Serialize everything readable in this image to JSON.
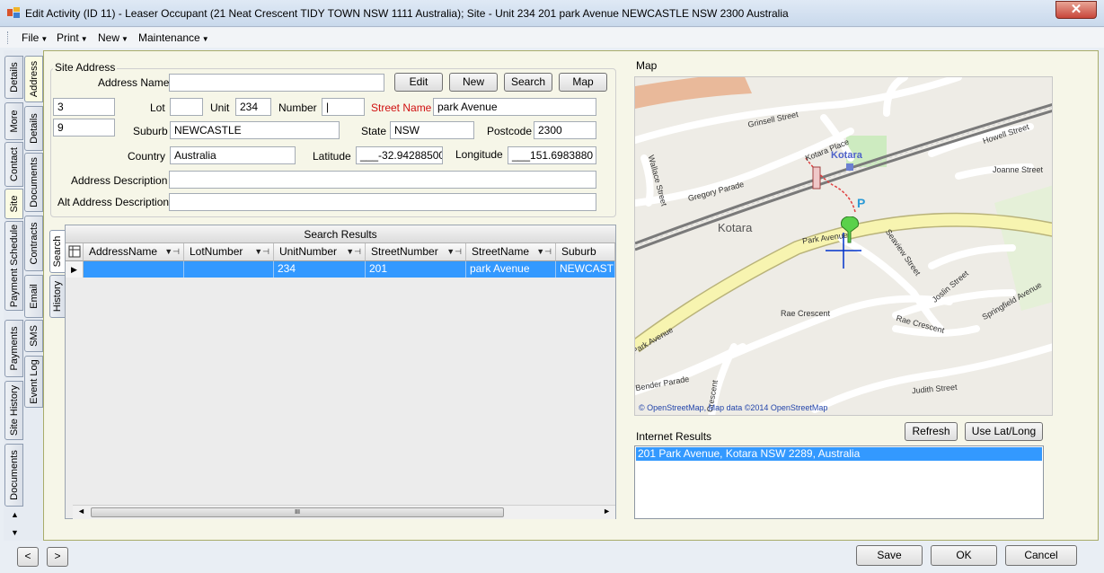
{
  "window": {
    "title": "Edit Activity (ID 11)  - Leaser Occupant (21 Neat Crescent TIDY TOWN NSW 1111 Australia); Site - Unit 234 201 park Avenue NEWCASTLE NSW  2300 Australia",
    "close": "✕"
  },
  "menu": {
    "file": "File",
    "print": "Print",
    "new": "New",
    "maintenance": "Maintenance"
  },
  "outer_tabs": [
    "Details",
    "More",
    "Contact",
    "Site",
    "Payment Schedule",
    "Payments",
    "Site History",
    "Documents"
  ],
  "inner_tabs": [
    "Address",
    "Details",
    "Documents",
    "Contracts",
    "Email",
    "SMS",
    "Event Log"
  ],
  "site_address": {
    "legend": "Site Address",
    "address_name_label": "Address Name",
    "address_name": "",
    "edit": "Edit",
    "new": "New",
    "search": "Search",
    "map": "Map",
    "field_a": "3",
    "field_b": "9",
    "lot_label": "Lot",
    "lot": "",
    "unit_label": "Unit",
    "unit": "234",
    "number_label": "Number",
    "number": "|",
    "street_name_label": "Street Name",
    "street_name": "park Avenue",
    "suburb_label": "Suburb",
    "suburb": "NEWCASTLE",
    "state_label": "State",
    "state": "NSW",
    "postcode_label": "Postcode",
    "postcode": "2300",
    "country_label": "Country",
    "country": "Australia",
    "latitude_label": "Latitude",
    "latitude": "___-32.94288500",
    "longitude_label": "Longitude",
    "longitude": "___151.6983880",
    "address_description_label": "Address Description",
    "address_description": "",
    "alt_address_description_label": "Alt Address Description",
    "alt_address_description": ""
  },
  "search_results": {
    "title": "Search Results",
    "side_tabs": [
      "Search",
      "History"
    ],
    "columns": [
      "AddressName",
      "LotNumber",
      "UnitNumber",
      "StreetNumber",
      "StreetName",
      "Suburb"
    ],
    "rows": [
      [
        "",
        "",
        "234",
        "201",
        "park Avenue",
        "NEWCASTLE"
      ]
    ],
    "scroll_grip": "III"
  },
  "map": {
    "label": "Map",
    "place_labels": {
      "kotara": "Kotara",
      "kotara_station": "Kotara",
      "kotara_place": "Kotara Place",
      "grinsell": "Grinsell Street",
      "howell": "Howell Street",
      "joanne": "Joanne Street",
      "wallace": "Wallace Street",
      "gregory": "Gregory Parade",
      "park": "Park Avenue",
      "park2": "Park Avenue",
      "seaview": "Seaview Street",
      "joslin": "Joslin Street",
      "springfield": "Springfield Avenue",
      "rae1": "Rae Crescent",
      "rae2": "Rae Crescent",
      "bender": "Bender Parade",
      "judith": "Judith Street",
      "crescent": "Crescent",
      "parking": "P"
    },
    "attribution": "© OpenStreetMap, Map data ©2014 OpenStreetMap",
    "colors": {
      "road_major": "#f7f4b0",
      "road": "#ffffff",
      "rail": "#7a7a7a",
      "park": "#cdebc0"
    }
  },
  "internet_results": {
    "label": "Internet Results",
    "refresh": "Refresh",
    "use_lat_long": "Use Lat/Long",
    "items": [
      "201 Park Avenue, Kotara NSW 2289, Australia"
    ]
  },
  "footer": {
    "prev": "<",
    "next": ">",
    "save": "Save",
    "ok": "OK",
    "cancel": "Cancel"
  }
}
